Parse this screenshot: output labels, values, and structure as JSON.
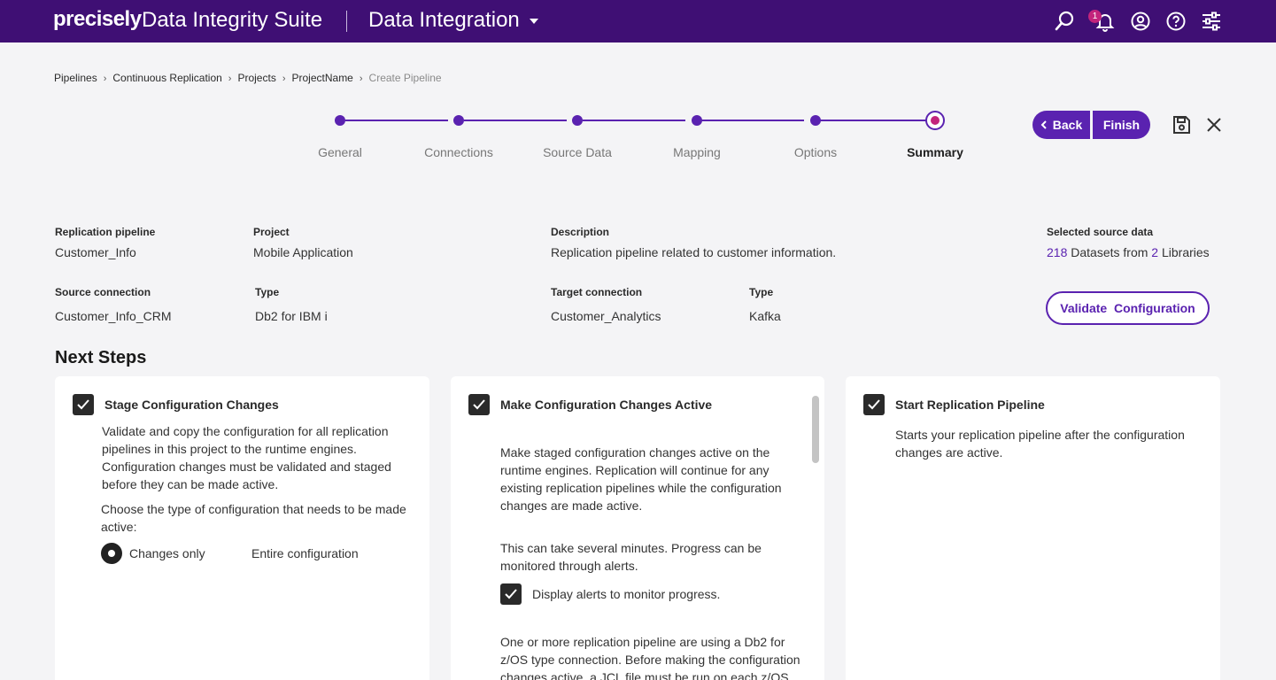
{
  "header": {
    "brand": "precisely",
    "suite": "Data Integrity Suite",
    "app": "Data Integration",
    "notification_count": "1",
    "icons": [
      "search-icon",
      "bell-icon",
      "user-icon",
      "help-icon",
      "settings-sliders-icon"
    ]
  },
  "breadcrumb": {
    "items": [
      "Pipelines",
      "Continuous Replication",
      "Projects",
      "ProjectName"
    ],
    "current": "Create Pipeline"
  },
  "stepper": {
    "steps": [
      "General",
      "Connections",
      "Source Data",
      "Mapping",
      "Options",
      "Summary"
    ],
    "active": "Summary"
  },
  "actions": {
    "back": "Back",
    "finish": "Finish"
  },
  "summary": {
    "pipeline_label": "Replication pipeline",
    "pipeline_value": "Customer_Info",
    "project_label": "Project",
    "project_value": "Mobile Application",
    "description_label": "Description",
    "description_value": "Replication pipeline related to customer information.",
    "selected_label": "Selected source data",
    "datasets_count": "218",
    "datasets_text": "Datasets from",
    "libraries_count": "2",
    "libraries_text": "Libraries",
    "source_conn_label": "Source connection",
    "source_conn_value": "Customer_Info_CRM",
    "source_type_label": "Type",
    "source_type_value": "Db2 for IBM i",
    "target_conn_label": "Target connection",
    "target_conn_value": "Customer_Analytics",
    "target_type_label": "Type",
    "target_type_value": "Kafka",
    "validate": "Validate  Configuration"
  },
  "next_steps": {
    "title": "Next Steps",
    "stage": {
      "title": "Stage Configuration Changes",
      "text1": "Validate and copy the configuration for all replication pipelines in this project to the runtime engines. Configuration changes must be validated and staged before they can be made active.",
      "text2": "Choose the type of configuration that needs to be made active:",
      "option1": "Changes only",
      "option2": "Entire configuration"
    },
    "activate": {
      "title": "Make Configuration Changes Active",
      "text1": "Make staged configuration changes active on the runtime engines. Replication will continue for any existing replication pipelines while the configuration changes are made active.",
      "text2": "This can take several minutes. Progress can be monitored through alerts.",
      "alerts_label": "Display alerts to monitor progress.",
      "text3": "One or more replication pipeline are using a Db2 for z/OS type connection. Before making the configuration changes active, a JCL file must be run on each z/OS"
    },
    "start": {
      "title": "Start Replication Pipeline",
      "text1": "Starts your replication pipeline after the configuration changes are active."
    }
  }
}
